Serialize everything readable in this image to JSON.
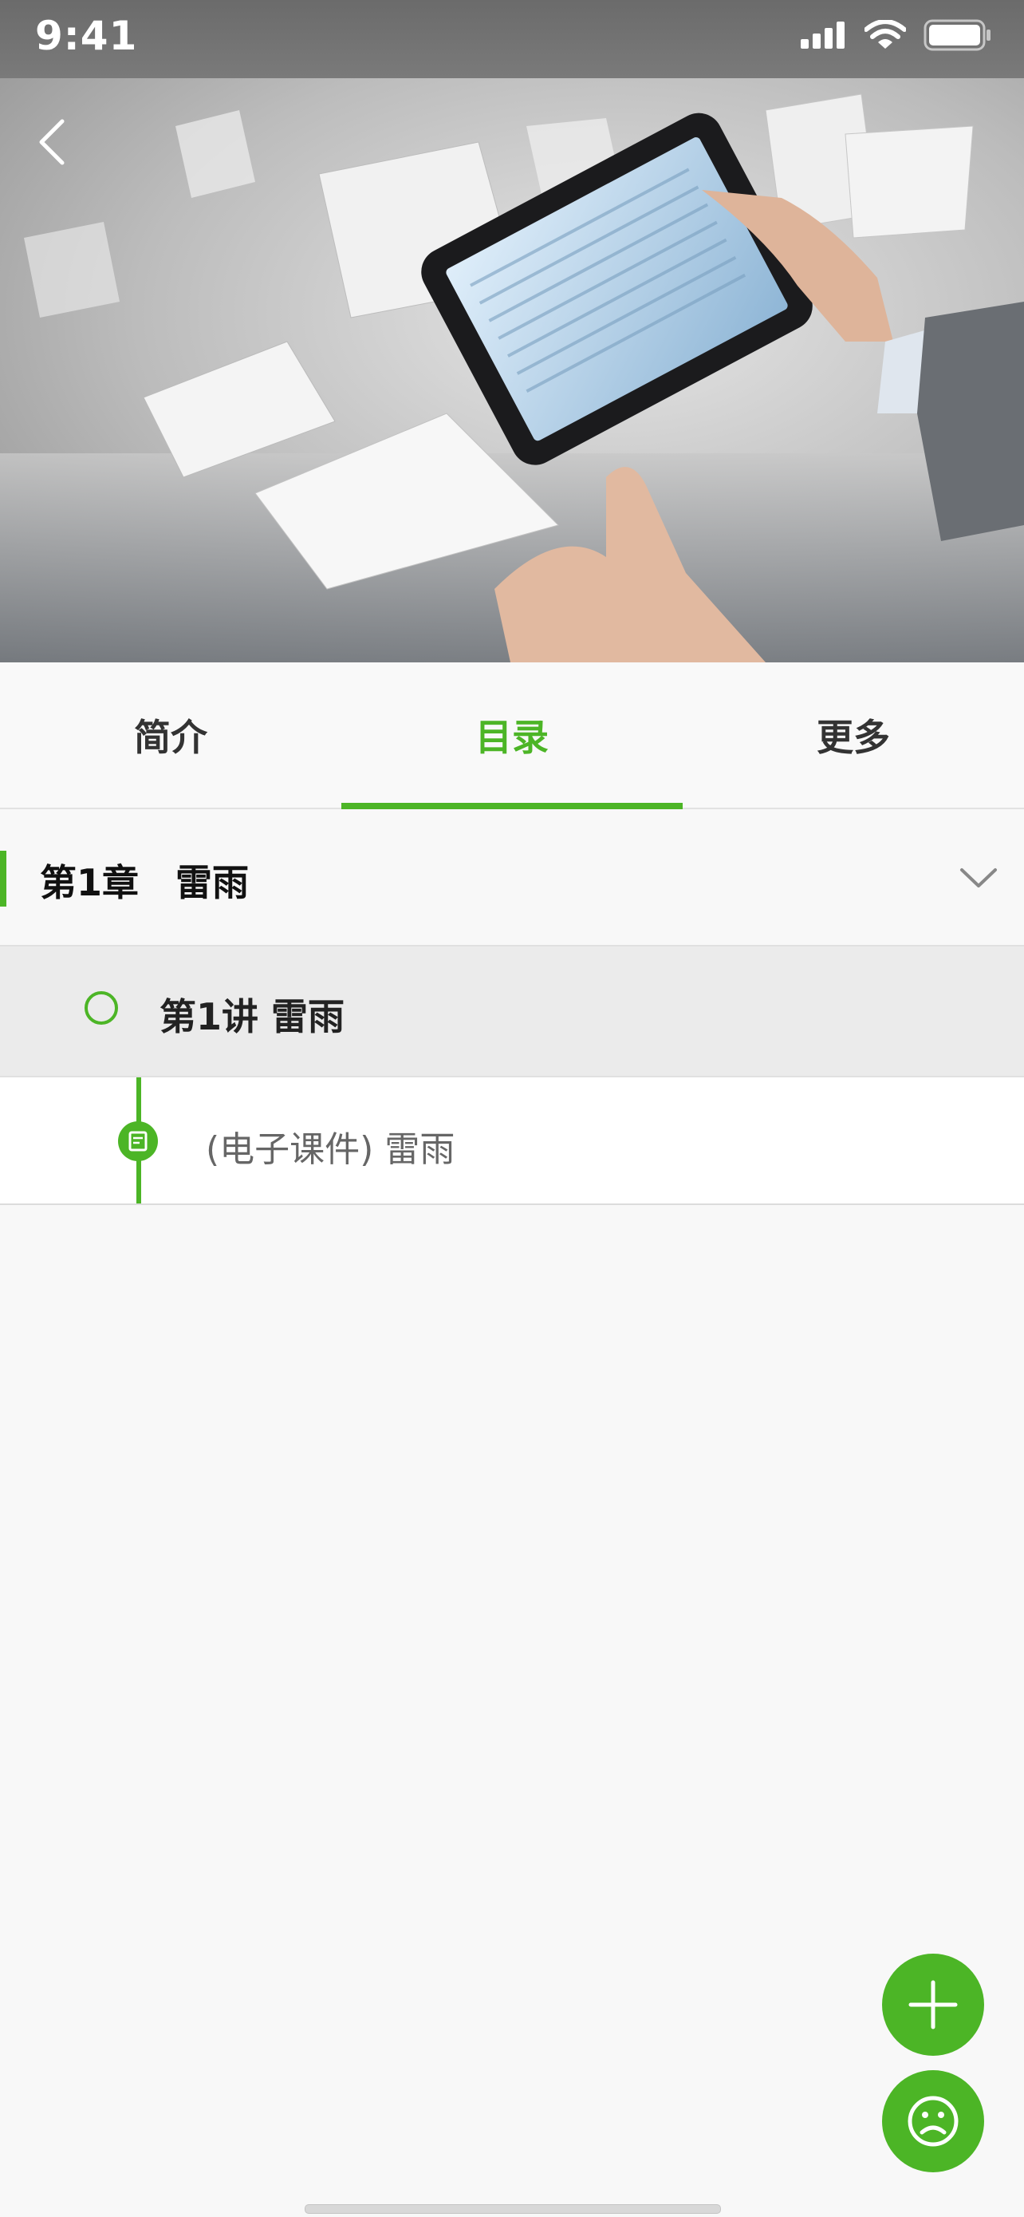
{
  "status_bar": {
    "time": "9:41"
  },
  "header": {
    "back_icon": "chevron-left-icon",
    "hero_image": "tablet-with-flying-documents"
  },
  "tabs": [
    {
      "label": "简介",
      "active": false
    },
    {
      "label": "目录",
      "active": true
    },
    {
      "label": "更多",
      "active": false
    }
  ],
  "chapter": {
    "label": "第1章　雷雨",
    "expand_icon": "chevron-down-icon"
  },
  "lecture": {
    "label": "第1讲 雷雨"
  },
  "resource": {
    "label": "(电子课件) 雷雨",
    "icon": "document-icon"
  },
  "fabs": {
    "add_icon": "plus-icon",
    "feedback_icon": "sad-face-icon"
  },
  "colors": {
    "accent": "#4cb526",
    "background": "#f8f8f8"
  }
}
